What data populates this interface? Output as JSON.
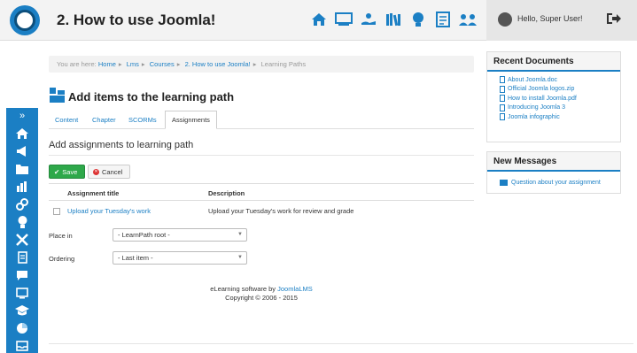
{
  "header": {
    "course_title": "2. How to use Joomla!",
    "user_greeting": "Hello, Super User!",
    "icons": [
      "home-icon",
      "presentation-icon",
      "hand-holding-icon",
      "library-icon",
      "lightbulb-icon",
      "checklist-icon",
      "group-icon"
    ]
  },
  "sidebar": {
    "toggle": "»",
    "icons": [
      "home-icon",
      "megaphone-icon",
      "folder-icon",
      "chart-icon",
      "link-icon",
      "bulb-icon",
      "tools-icon",
      "document-icon",
      "chat-icon",
      "presentation-icon",
      "graduation-cap-icon",
      "pie-chart-icon",
      "inbox-icon"
    ]
  },
  "breadcrumb": {
    "prefix": "You are here:",
    "items": [
      "Home",
      "Lms",
      "Courses",
      "2. How to use Joomla!"
    ],
    "current": "Learning Paths"
  },
  "page": {
    "title": "Add items to the learning path",
    "tabs": [
      "Content",
      "Chapter",
      "SCORMs",
      "Assignments"
    ],
    "active_tab": "Assignments",
    "section_heading": "Add assignments to learning path"
  },
  "toolbar": {
    "save_label": "Save",
    "cancel_label": "Cancel"
  },
  "table": {
    "columns": [
      "Assignment title",
      "Description"
    ],
    "rows": [
      {
        "title": "Upload your Tuesday's work",
        "description": "Upload your Tuesday's work for review and grade"
      }
    ]
  },
  "form": {
    "place_in_label": "Place in",
    "place_in_value": "- LearnPath root -",
    "ordering_label": "Ordering",
    "ordering_value": "- Last item -"
  },
  "footer": {
    "software_prefix": "eLearning software by",
    "software_link": "JoomlaLMS",
    "copyright": "Copyright © 2006 - 2015"
  },
  "recent_documents": {
    "title": "Recent Documents",
    "items": [
      "About Joomla.doc",
      "Official Joomla logos.zip",
      "How to install Joomla.pdf",
      "Introducing Joomla 3",
      "Joomla infographic"
    ]
  },
  "new_messages": {
    "title": "New Messages",
    "items": [
      "Question about your assignment"
    ]
  },
  "colors": {
    "accent": "#1b7fc4",
    "save_green": "#2ea84a",
    "cancel_red": "#dd3333"
  }
}
